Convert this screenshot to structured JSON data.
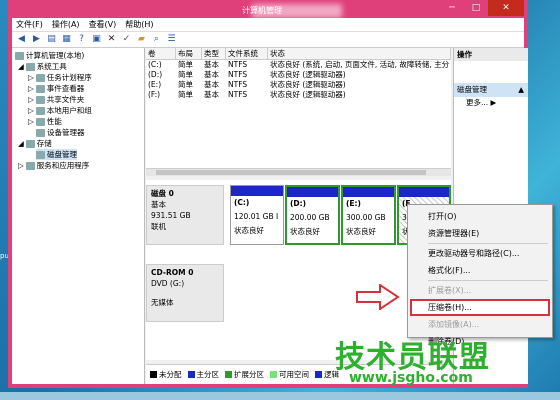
{
  "desktop": {
    "side_label": "pu"
  },
  "window": {
    "title": "计算机管理"
  },
  "menu": [
    "文件(F)",
    "操作(A)",
    "查看(V)",
    "帮助(H)"
  ],
  "tree": [
    {
      "label": "计算机管理(本地)",
      "level": 0
    },
    {
      "label": "系统工具",
      "level": 1
    },
    {
      "label": "任务计划程序",
      "level": 2
    },
    {
      "label": "事件查看器",
      "level": 2
    },
    {
      "label": "共享文件夹",
      "level": 2
    },
    {
      "label": "本地用户和组",
      "level": 2
    },
    {
      "label": "性能",
      "level": 2
    },
    {
      "label": "设备管理器",
      "level": 2
    },
    {
      "label": "存储",
      "level": 1
    },
    {
      "label": "磁盘管理",
      "level": 2,
      "selected": true
    },
    {
      "label": "服务和应用程序",
      "level": 1
    }
  ],
  "volumes": {
    "columns": [
      "卷",
      "布局",
      "类型",
      "文件系统",
      "状态"
    ],
    "rows": [
      [
        "(C:)",
        "简单",
        "基本",
        "NTFS",
        "状态良好 (系统, 启动, 页面文件, 活动, 故障转储, 主分"
      ],
      [
        "(D:)",
        "简单",
        "基本",
        "NTFS",
        "状态良好 (逻辑驱动器)"
      ],
      [
        "(E:)",
        "简单",
        "基本",
        "NTFS",
        "状态良好 (逻辑驱动器)"
      ],
      [
        "(F:)",
        "简单",
        "基本",
        "NTFS",
        "状态良好 (逻辑驱动器)"
      ]
    ]
  },
  "disk0": {
    "name": "磁盘 0",
    "type": "基本",
    "size": "931.51 GB",
    "status": "联机",
    "partitions": [
      {
        "name": "(C:)",
        "size": "120.01 GB I",
        "status": "状态良好"
      },
      {
        "name": "(D:)",
        "size": "200.00 GB",
        "status": "状态良好"
      },
      {
        "name": "(E:)",
        "size": "300.00 GB",
        "status": "状态良好"
      },
      {
        "name": "(F",
        "size": "311",
        "status": "状态"
      }
    ]
  },
  "cdrom": {
    "name": "CD-ROM 0",
    "type": "DVD (G:)",
    "status": "无媒体"
  },
  "legend": [
    {
      "label": "未分配",
      "color": "#000000"
    },
    {
      "label": "主分区",
      "color": "#1c27c8"
    },
    {
      "label": "扩展分区",
      "color": "#2c9b2c"
    },
    {
      "label": "可用空间",
      "color": "#7be07b"
    },
    {
      "label": "逻辑",
      "color": "#1c27c8"
    }
  ],
  "actions": {
    "header": "操作",
    "group": "磁盘管理",
    "more": "更多..."
  },
  "context_menu": [
    {
      "label": "打开(O)",
      "state": "normal"
    },
    {
      "label": "资源管理器(E)",
      "state": "normal"
    },
    {
      "label": "sep"
    },
    {
      "label": "更改驱动器号和路径(C)...",
      "state": "normal"
    },
    {
      "label": "格式化(F)...",
      "state": "normal"
    },
    {
      "label": "sep"
    },
    {
      "label": "扩展卷(X)...",
      "state": "disabled"
    },
    {
      "label": "压缩卷(H)...",
      "state": "highlighted"
    },
    {
      "label": "添加镜像(A)...",
      "state": "disabled"
    },
    {
      "label": "删除卷(D)...",
      "state": "normal"
    }
  ],
  "watermark": {
    "text": "技术员联盟",
    "url": "www.jsgho.com"
  }
}
